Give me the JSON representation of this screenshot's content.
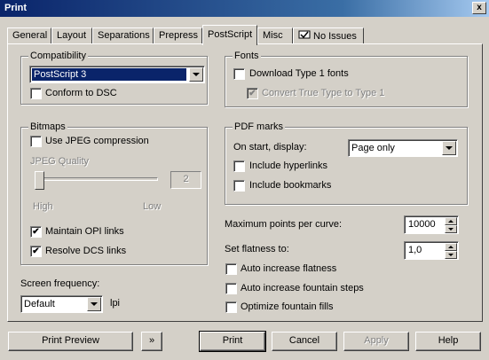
{
  "window": {
    "title": "Print",
    "close_glyph": "x"
  },
  "tabs": [
    {
      "label": "General"
    },
    {
      "label": "Layout"
    },
    {
      "label": "Separations"
    },
    {
      "label": "Prepress"
    },
    {
      "label": "PostScript",
      "active": true
    },
    {
      "label": "Misc"
    },
    {
      "label": "No Issues",
      "icon": "issues-checkmark-icon"
    }
  ],
  "compatibility": {
    "label": "Compatibility",
    "level": "PostScript 3",
    "conform_dsc": {
      "label": "Conform to DSC",
      "checked": false
    }
  },
  "bitmaps": {
    "label": "Bitmaps",
    "use_jpeg": {
      "label": "Use JPEG compression",
      "checked": false
    },
    "jpeg_quality_label": "JPEG Quality",
    "jpeg_quality_value": "2",
    "high_label": "High",
    "low_label": "Low",
    "maintain_opi": {
      "label": "Maintain OPI links",
      "checked": true
    },
    "resolve_dcs": {
      "label": "Resolve DCS links",
      "checked": true
    }
  },
  "screen_frequency": {
    "label": "Screen frequency:",
    "value": "Default",
    "unit": "lpi"
  },
  "fonts": {
    "label": "Fonts",
    "download_type1": {
      "label": "Download Type 1 fonts",
      "checked": false
    },
    "convert_truetype": {
      "label": "Convert True Type to Type 1",
      "checked": true,
      "disabled": true
    }
  },
  "pdf_marks": {
    "label": "PDF marks",
    "on_start_label": "On start, display:",
    "on_start_value": "Page only",
    "include_hyperlinks": {
      "label": "Include hyperlinks",
      "checked": false
    },
    "include_bookmarks": {
      "label": "Include bookmarks",
      "checked": false
    }
  },
  "max_points": {
    "label": "Maximum points per curve:",
    "value": "10000"
  },
  "flatness": {
    "label": "Set flatness to:",
    "value": "1,0"
  },
  "auto_flatness": {
    "label": "Auto increase flatness",
    "checked": false
  },
  "auto_fountain": {
    "label": "Auto increase fountain steps",
    "checked": false
  },
  "optimize_fountain": {
    "label": "Optimize fountain fills",
    "checked": false
  },
  "buttons": {
    "print_preview": "Print Preview",
    "expand_glyph": "»",
    "print": "Print",
    "cancel": "Cancel",
    "apply": "Apply",
    "help": "Help"
  },
  "checkmark": "✔"
}
